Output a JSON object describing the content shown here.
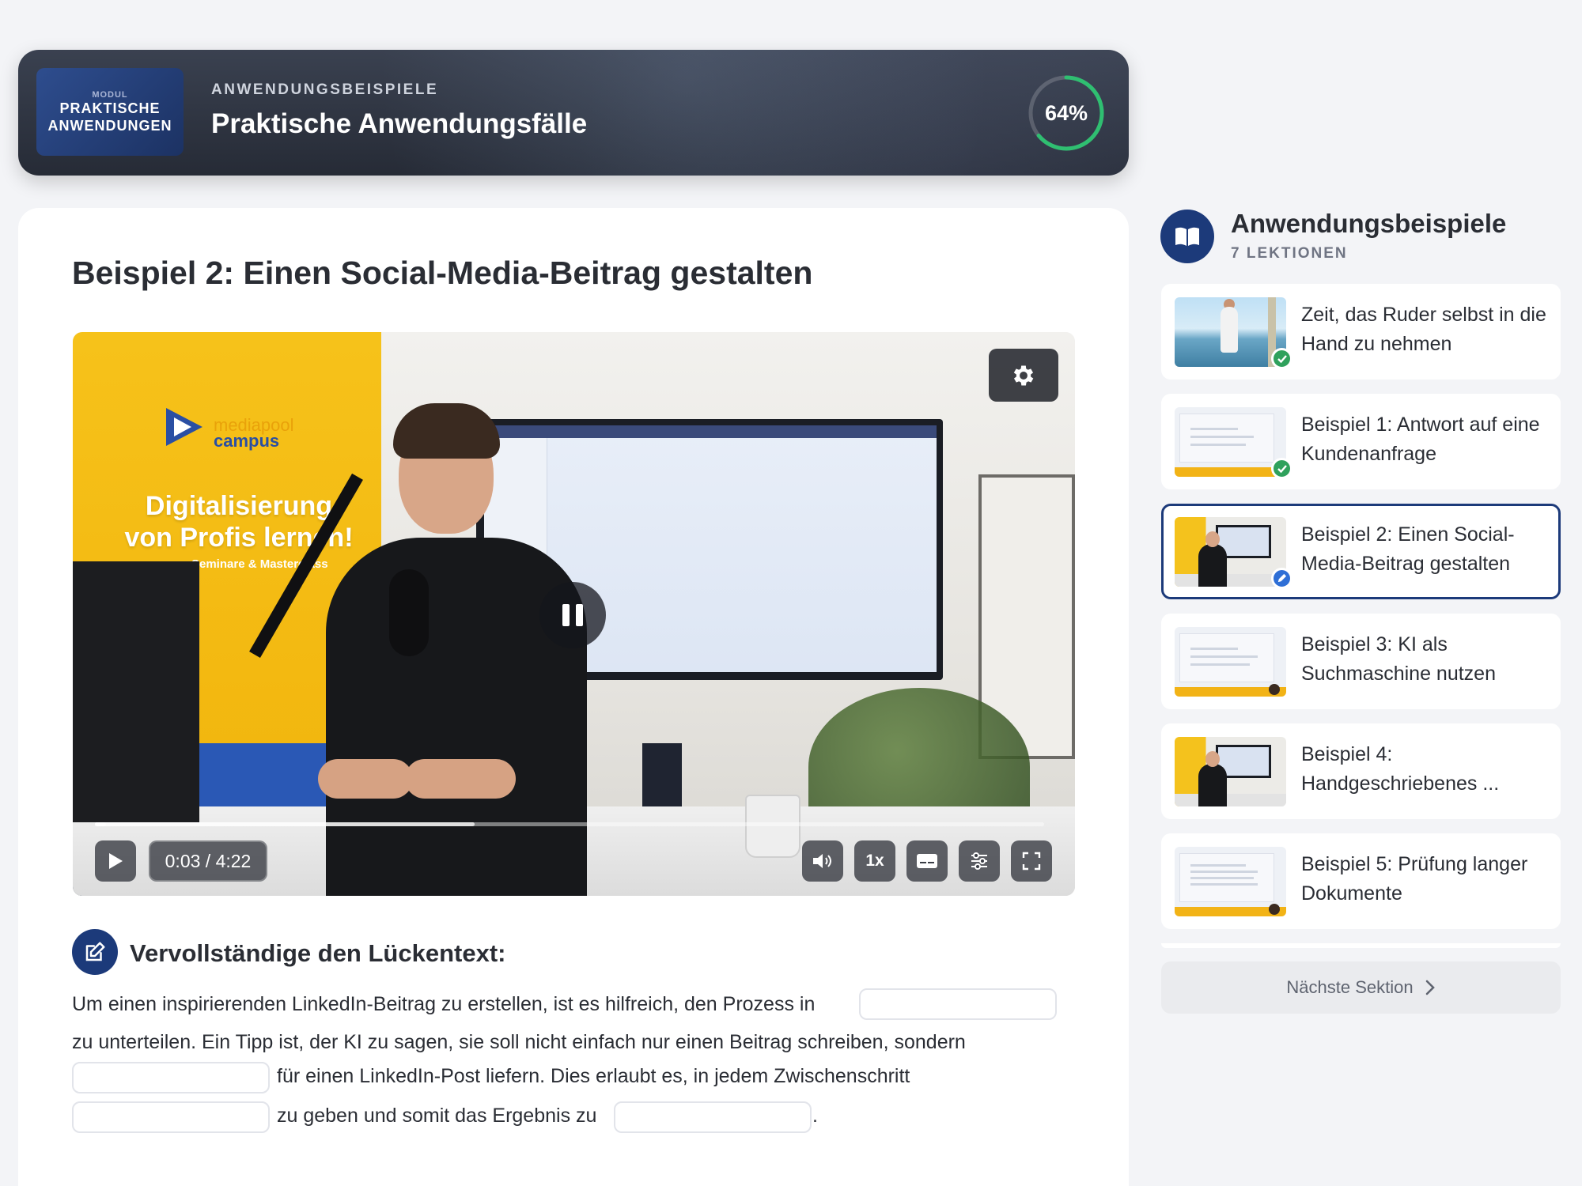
{
  "header": {
    "module_thumb_small": "MODUL",
    "module_thumb_line1": "PRAKTISCHE",
    "module_thumb_line2": "ANWENDUNGEN",
    "kicker": "ANWENDUNGSBEISPIELE",
    "title": "Praktische Anwendungsfälle",
    "progress_percent": 64,
    "progress_label": "64%",
    "progress_color": "#2fbf71"
  },
  "lesson": {
    "title": "Beispiel 2: Einen Social-Media-Beitrag gestalten"
  },
  "video": {
    "banner_brand_1": "mediapool",
    "banner_brand_2": "campus",
    "banner_line1": "Digitalisierung",
    "banner_line2": "von Profis lernen!",
    "banner_sub": "Seminare & Masterclass",
    "time": "0:03 / 4:22",
    "speed": "1x",
    "played_fraction": 0.012,
    "buffered_fraction": 0.4,
    "state": "playing"
  },
  "exercise": {
    "heading": "Vervollständige den Lückentext:",
    "segment1": "Um einen inspirierenden LinkedIn-Beitrag zu erstellen, ist es hilfreich, den Prozess in",
    "segment2": "zu unterteilen. Ein Tipp ist, der KI zu sagen, sie soll nicht einfach nur einen Beitrag schreiben, sondern",
    "segment3": "für einen LinkedIn-Post liefern. Dies erlaubt es, in jedem Zwischenschritt",
    "segment4": "zu geben und somit das Ergebnis zu",
    "segment5": ".",
    "gaps": [
      "",
      "",
      "",
      ""
    ]
  },
  "sidebar": {
    "title": "Anwendungsbeispiele",
    "count": "7 LEKTIONEN",
    "lessons": [
      {
        "title": "Zeit, das Ruder selbst in die Hand zu nehmen",
        "status": "done"
      },
      {
        "title": "Beispiel 1: Antwort auf eine Kundenanfrage",
        "status": "done"
      },
      {
        "title": "Beispiel 2: Einen Social-Media-Beitrag gestalten",
        "status": "current"
      },
      {
        "title": "Beispiel 3: KI als Suchmaschine nutzen",
        "status": "open"
      },
      {
        "title": "Beispiel 4: Handgeschriebenes ...",
        "status": "open"
      },
      {
        "title": "Beispiel 5: Prüfung langer Dokumente",
        "status": "open"
      }
    ],
    "next_label": "Nächste Sektion"
  },
  "colors": {
    "accent_navy": "#1c3a7a",
    "done_green": "#2fa15c",
    "current_blue": "#2f6fd6",
    "brand_yellow": "#f2b316"
  }
}
